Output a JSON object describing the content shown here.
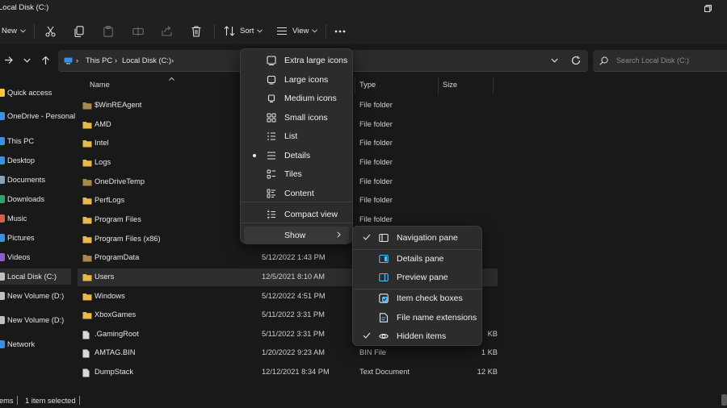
{
  "window": {
    "title": "Local Disk (C:)"
  },
  "toolbar": {
    "new_label": "New",
    "sort_label": "Sort",
    "view_label": "View"
  },
  "address": {
    "crumbs": [
      "This PC",
      "Local Disk (C:)"
    ],
    "search_placeholder": "Search Local Disk (C:)"
  },
  "sidebar": {
    "items": [
      {
        "label": "Quick access",
        "icon": "star-icon",
        "color": "#f6c343"
      },
      {
        "label": "OneDrive - Personal",
        "icon": "cloud-icon",
        "color": "#3a8ee6"
      },
      {
        "label": "This PC",
        "icon": "pc-icon",
        "color": "#3a8ee6"
      },
      {
        "label": "Desktop",
        "icon": "desktop-icon",
        "color": "#3a8ee6"
      },
      {
        "label": "Documents",
        "icon": "documents-icon",
        "color": "#8aa0b8"
      },
      {
        "label": "Downloads",
        "icon": "downloads-icon",
        "color": "#2ea36b"
      },
      {
        "label": "Music",
        "icon": "music-icon",
        "color": "#e05a4a"
      },
      {
        "label": "Pictures",
        "icon": "pictures-icon",
        "color": "#3a8ee6"
      },
      {
        "label": "Videos",
        "icon": "videos-icon",
        "color": "#8a5cd6"
      },
      {
        "label": "Local Disk (C:)",
        "icon": "drive-icon",
        "color": "#bfbfbf"
      },
      {
        "label": "New Volume (D:)",
        "icon": "drive-icon",
        "color": "#bfbfbf"
      },
      {
        "label": "New Volume (D:)",
        "icon": "drive-icon",
        "color": "#bfbfbf"
      },
      {
        "label": "Network",
        "icon": "network-icon",
        "color": "#3a8ee6"
      }
    ]
  },
  "columns": {
    "name": "Name",
    "type": "Type",
    "size": "Size"
  },
  "files": [
    {
      "name": "$WinREAgent",
      "date": "",
      "type": "File folder",
      "size": "",
      "kind": "folder-dim"
    },
    {
      "name": "AMD",
      "date": "",
      "type": "File folder",
      "size": "",
      "kind": "folder"
    },
    {
      "name": "Intel",
      "date": "",
      "type": "File folder",
      "size": "",
      "kind": "folder"
    },
    {
      "name": "Logs",
      "date": "",
      "type": "File folder",
      "size": "",
      "kind": "folder"
    },
    {
      "name": "OneDriveTemp",
      "date": "",
      "type": "File folder",
      "size": "",
      "kind": "folder-dim"
    },
    {
      "name": "PerfLogs",
      "date": "",
      "type": "File folder",
      "size": "",
      "kind": "folder"
    },
    {
      "name": "Program Files",
      "date": "",
      "type": "File folder",
      "size": "",
      "kind": "folder"
    },
    {
      "name": "Program Files (x86)",
      "date": "",
      "type": "",
      "size": "",
      "kind": "folder"
    },
    {
      "name": "ProgramData",
      "date": "5/12/2022 1:43 PM",
      "type": "",
      "size": "",
      "kind": "folder-dim"
    },
    {
      "name": "Users",
      "date": "12/5/2021 8:10 AM",
      "type": "",
      "size": "",
      "kind": "folder"
    },
    {
      "name": "Windows",
      "date": "5/12/2022 4:51 PM",
      "type": "",
      "size": "",
      "kind": "folder"
    },
    {
      "name": "XboxGames",
      "date": "5/11/2022 3:31 PM",
      "type": "",
      "size": "",
      "kind": "folder"
    },
    {
      "name": ".GamingRoot",
      "date": "5/11/2022 3:31 PM",
      "type": "",
      "size": "KB",
      "kind": "file"
    },
    {
      "name": "AMTAG.BIN",
      "date": "1/20/2022 9:23 AM",
      "type": "BIN File",
      "size": "1 KB",
      "kind": "file"
    },
    {
      "name": "DumpStack",
      "date": "12/12/2021 8:34 PM",
      "type": "Text Document",
      "size": "12 KB",
      "kind": "file"
    }
  ],
  "view_menu": {
    "items": [
      {
        "label": "Extra large icons",
        "icon": "extra-large-icons-icon"
      },
      {
        "label": "Large icons",
        "icon": "large-icons-icon"
      },
      {
        "label": "Medium icons",
        "icon": "medium-icons-icon"
      },
      {
        "label": "Small icons",
        "icon": "small-icons-icon"
      },
      {
        "label": "List",
        "icon": "list-icon"
      },
      {
        "label": "Details",
        "icon": "details-icon",
        "selected": true
      },
      {
        "label": "Tiles",
        "icon": "tiles-icon"
      },
      {
        "label": "Content",
        "icon": "content-icon"
      },
      {
        "label": "Compact view",
        "icon": "compact-view-icon"
      },
      {
        "label": "Show",
        "icon": "",
        "submenu": true
      }
    ]
  },
  "show_menu": {
    "items": [
      {
        "label": "Navigation pane",
        "icon": "navigation-pane-icon",
        "checked": true
      },
      {
        "label": "Details pane",
        "icon": "details-pane-icon",
        "checked": false
      },
      {
        "label": "Preview pane",
        "icon": "preview-pane-icon",
        "checked": false
      },
      {
        "label": "Item check boxes",
        "icon": "item-check-boxes-icon",
        "checked": false
      },
      {
        "label": "File name extensions",
        "icon": "file-name-extensions-icon",
        "checked": false
      },
      {
        "label": "Hidden items",
        "icon": "hidden-items-icon",
        "checked": true
      }
    ]
  },
  "status": {
    "count_fragment": "ems",
    "selected_text": "1 item selected"
  },
  "colors": {
    "folder": "#e8b84a",
    "folder_dim": "#a8884a",
    "accent": "#4cc2ff"
  }
}
